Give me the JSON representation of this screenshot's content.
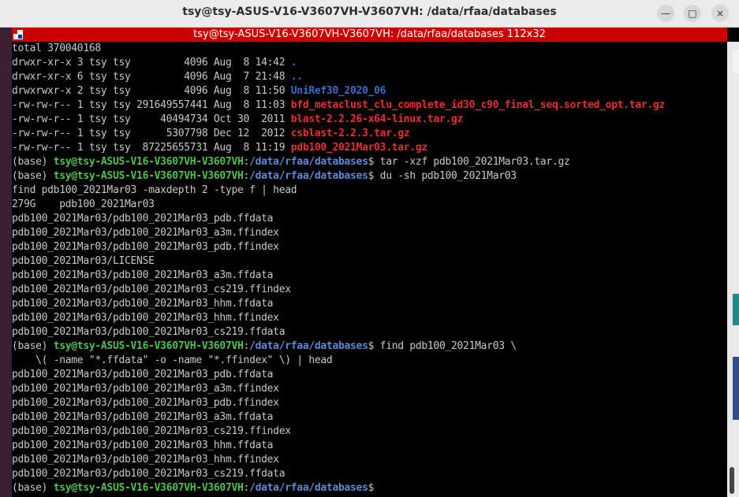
{
  "window": {
    "title": "tsy@tsy-ASUS-V16-V3607VH-V3607VH: /data/rfaa/databases",
    "subtitle": "tsy@tsy-ASUS-V16-V3607VH-V3607VH: /data/rfaa/databases 112x32",
    "minimize_icon": "minimize-icon",
    "maximize_icon": "maximize-icon",
    "close_icon": "close-icon",
    "minimize_glyph": "—",
    "maximize_glyph": "□",
    "close_glyph": "×",
    "accent_color": "#cc0000"
  },
  "prompt": {
    "prefix": "(base) ",
    "user_host": "tsy@tsy-ASUS-V16-V3607VH-V3607VH",
    "colon": ":",
    "path": "/data/rfaa/databases",
    "symbol": "$"
  },
  "listing": {
    "total": "total 370040168",
    "entries": [
      {
        "meta": "drwxr-xr-x 3 tsy tsy         4096 Aug  8 14:42 ",
        "name": "."
      },
      {
        "meta": "drwxr-xr-x 6 tsy tsy         4096 Aug  7 21:48 ",
        "name": ".."
      },
      {
        "meta": "drwxrwxr-x 2 tsy tsy         4096 Aug  8 11:50 ",
        "name": "UniRef30_2020_06"
      },
      {
        "meta": "-rw-rw-r-- 1 tsy tsy 291649557441 Aug  8 11:03 ",
        "name": "bfd_metaclust_clu_complete_id30_c90_final_seq.sorted_opt.tar.gz"
      },
      {
        "meta": "-rw-rw-r-- 1 tsy tsy     40494734 Oct 30  2011 ",
        "name": "blast-2.2.26-x64-linux.tar.gz"
      },
      {
        "meta": "-rw-rw-r-- 1 tsy tsy      5307798 Dec 12  2012 ",
        "name": "csblast-2.2.3.tar.gz"
      },
      {
        "meta": "-rw-rw-r-- 1 tsy tsy  87225655731 Aug  8 11:19 ",
        "name": "pdb100_2021Mar03.tar.gz"
      }
    ]
  },
  "commands": {
    "c1": " tar -xzf pdb100_2021Mar03.tar.gz",
    "c2": " du -sh pdb100_2021Mar03",
    "c2b": "find pdb100_2021Mar03 -maxdepth 2 -type f | head",
    "c3": " find pdb100_2021Mar03 \\",
    "c3b": "    \\( -name \"*.ffdata\" -o -name \"*.ffindex\" \\) | head"
  },
  "du_output": "279G    pdb100_2021Mar03",
  "find1_output": [
    "pdb100_2021Mar03/pdb100_2021Mar03_pdb.ffdata",
    "pdb100_2021Mar03/pdb100_2021Mar03_a3m.ffindex",
    "pdb100_2021Mar03/pdb100_2021Mar03_pdb.ffindex",
    "pdb100_2021Mar03/LICENSE",
    "pdb100_2021Mar03/pdb100_2021Mar03_a3m.ffdata",
    "pdb100_2021Mar03/pdb100_2021Mar03_cs219.ffindex",
    "pdb100_2021Mar03/pdb100_2021Mar03_hhm.ffdata",
    "pdb100_2021Mar03/pdb100_2021Mar03_hhm.ffindex",
    "pdb100_2021Mar03/pdb100_2021Mar03_cs219.ffdata"
  ],
  "find2_output": [
    "pdb100_2021Mar03/pdb100_2021Mar03_pdb.ffdata",
    "pdb100_2021Mar03/pdb100_2021Mar03_a3m.ffindex",
    "pdb100_2021Mar03/pdb100_2021Mar03_pdb.ffindex",
    "pdb100_2021Mar03/pdb100_2021Mar03_a3m.ffdata",
    "pdb100_2021Mar03/pdb100_2021Mar03_cs219.ffindex",
    "pdb100_2021Mar03/pdb100_2021Mar03_hhm.ffdata",
    "pdb100_2021Mar03/pdb100_2021Mar03_hhm.ffindex",
    "pdb100_2021Mar03/pdb100_2021Mar03_cs219.ffdata"
  ],
  "colors": {
    "prompt_user": "#4ec24e",
    "prompt_path": "#5c8ad8",
    "archive": "#e83030",
    "directory": "#3a6cc8",
    "text": "#c8c8c8"
  }
}
